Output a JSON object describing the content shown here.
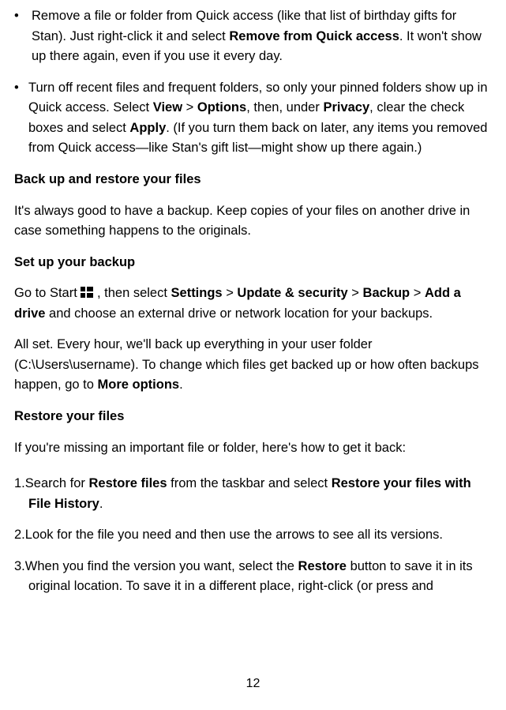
{
  "bullet1": {
    "pre": "Remove a file or folder from Quick access (like that list of birthday gifts for Stan). Just right-click it and select ",
    "bold1": "Remove from Quick access",
    "post": ". It won't show up there again, even if you use it every day."
  },
  "bullet2": {
    "pre": "Turn off recent files and frequent folders, so only your pinned folders show up in Quick access. Select ",
    "bold_view": "View",
    "gt1": " > ",
    "bold_options": "Options",
    "mid1": ", then, under ",
    "bold_privacy": "Privacy",
    "mid2": ", clear the check boxes and select ",
    "bold_apply": "Apply",
    "post": ". (If you turn them back on later, any items you removed from Quick access—like Stan's gift list—might show up there again.)"
  },
  "heading_backup": "Back up and restore your files",
  "para_backup": "It's always good to have a backup. Keep copies of your files on another drive in case something happens to the originals.",
  "heading_setup": "Set up your backup",
  "para_setup": {
    "pre": "Go to Start ",
    "mid1": " , then select ",
    "bold_settings": "Settings",
    "gt1": " > ",
    "bold_update": "Update & security",
    "gt2": " > ",
    "bold_backup": "Backup",
    "gt3": " > ",
    "bold_add": "Add a drive",
    "post": " and choose an external drive or network location for your backups."
  },
  "para_allset": {
    "pre": "All set. Every hour, we'll back up everything in your user folder (C:\\Users\\username). To change which files get backed up or how often backups happen, go to ",
    "bold_more": "More options",
    "post": "."
  },
  "heading_restore": "Restore your files",
  "para_restore": "If you're missing an important file or folder, here's how to get it back:",
  "step1": {
    "num": "1.",
    "pre": "Search for ",
    "bold_rf": "Restore files",
    "mid": " from the taskbar and select ",
    "bold_rfh": "Restore your files with File History",
    "post": "."
  },
  "step2": {
    "num": "2.",
    "text": "Look for the file you need and then use the arrows to see all its versions."
  },
  "step3": {
    "num": "3.",
    "pre": "When you find the version you want, select the ",
    "bold_restore": "Restore",
    "post": " button to save it in its original location. To save it in a different place, right-click (or press and"
  },
  "page_number": "12"
}
